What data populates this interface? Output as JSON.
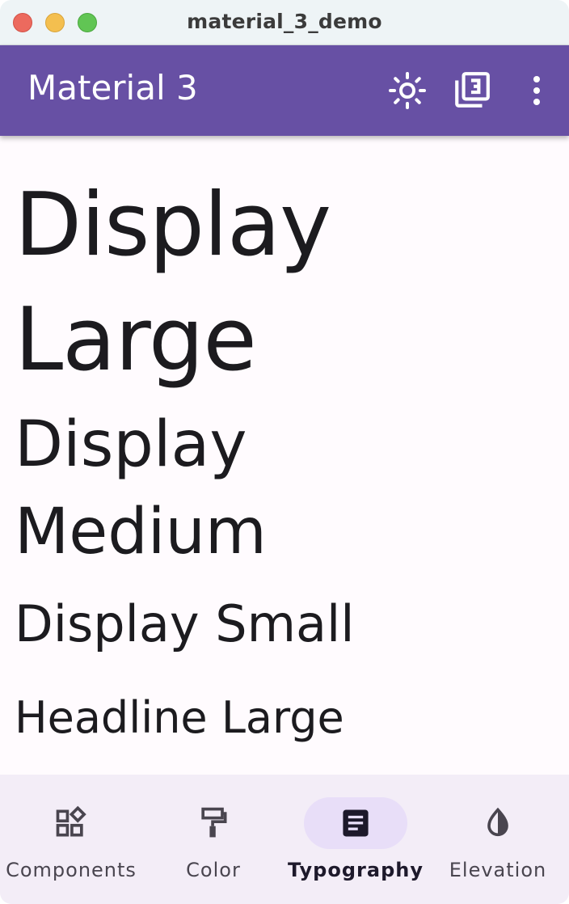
{
  "window": {
    "title": "material_3_demo"
  },
  "appbar": {
    "title": "Material 3",
    "actions": [
      {
        "icon": "brightness-icon"
      },
      {
        "icon": "material-3-icon"
      },
      {
        "icon": "more-vert-icon"
      }
    ],
    "background": "#6750a4"
  },
  "typography": {
    "display_large": "Display Large",
    "display_medium": "Display Medium",
    "display_small": "Display Small",
    "headline_large": "Headline Large"
  },
  "bottom_nav": {
    "items": [
      {
        "label": "Components",
        "icon": "widgets-icon",
        "selected": false
      },
      {
        "label": "Color",
        "icon": "format-paint-icon",
        "selected": false
      },
      {
        "label": "Typography",
        "icon": "article-icon",
        "selected": true
      },
      {
        "label": "Elevation",
        "icon": "opacity-icon",
        "selected": false
      }
    ],
    "indicator_color": "#e8def8",
    "background": "#f3edf7"
  },
  "colors": {
    "surface": "#fffbfe",
    "on_surface": "#1c1b1f",
    "on_surface_variant": "#49454f"
  }
}
